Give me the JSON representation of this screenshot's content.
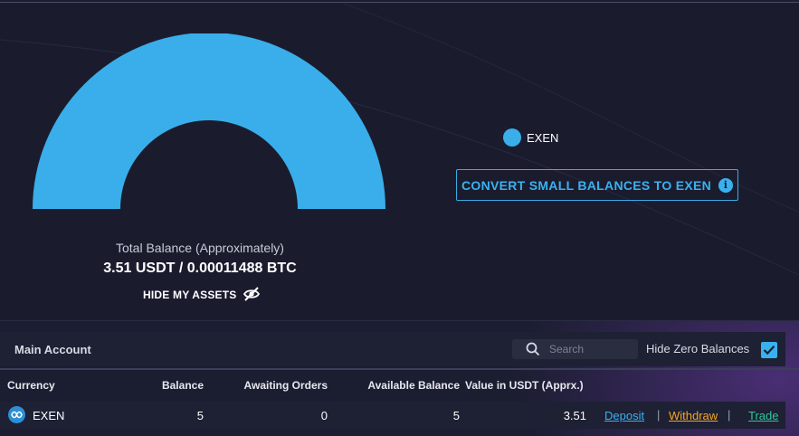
{
  "colors": {
    "accent": "#39aeea",
    "deposit": "#3ab1ef",
    "withdraw": "#f5a623",
    "trade": "#2ec79a"
  },
  "chart_data": {
    "type": "pie",
    "categories": [
      "EXEN"
    ],
    "values": [
      100
    ],
    "title": "",
    "legend_position": "right"
  },
  "summary": {
    "total_label": "Total Balance (Approximately)",
    "total_value": "3.51 USDT / 0.00011488 BTC",
    "hide_assets_label": "HIDE MY ASSETS",
    "hide_icon": "eye-slash-icon"
  },
  "legend": [
    {
      "label": "EXEN",
      "color": "#39aeea"
    }
  ],
  "convert": {
    "label": "CONVERT SMALL BALANCES TO EXEN",
    "info_icon": "info-icon"
  },
  "account": {
    "title": "Main Account",
    "search_placeholder": "Search",
    "search_icon": "search-icon",
    "hide_zero_label": "Hide Zero Balances",
    "hide_zero_checked": true
  },
  "table": {
    "headers": {
      "currency": "Currency",
      "balance": "Balance",
      "awaiting": "Awaiting Orders",
      "available": "Available Balance",
      "value": "Value in USDT (Apprx.)"
    },
    "rows": [
      {
        "currency": "EXEN",
        "balance": "5",
        "awaiting": "0",
        "available": "5",
        "value": "3.51",
        "actions": {
          "deposit": "Deposit",
          "withdraw": "Withdraw",
          "trade": "Trade",
          "separator": "|"
        }
      }
    ]
  }
}
